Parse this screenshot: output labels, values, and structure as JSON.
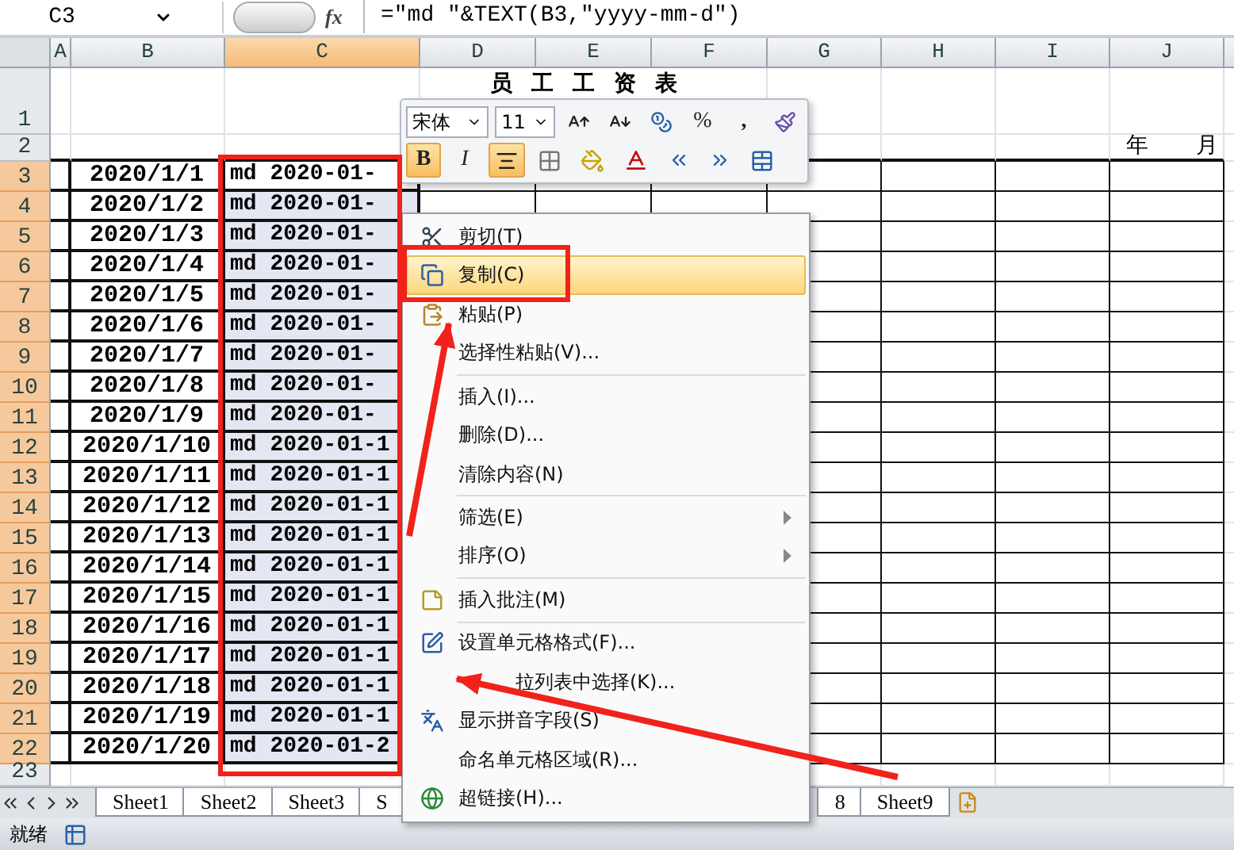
{
  "formula_bar": {
    "name_box": "C3",
    "fx": "fx",
    "formula": "=\"md \"&TEXT(B3,\"yyyy-mm-d\")"
  },
  "columns": [
    {
      "label": "A",
      "selected": false
    },
    {
      "label": "B",
      "selected": false
    },
    {
      "label": "C",
      "selected": true
    },
    {
      "label": "D",
      "selected": false
    },
    {
      "label": "E",
      "selected": false
    },
    {
      "label": "F",
      "selected": false
    },
    {
      "label": "G",
      "selected": false
    },
    {
      "label": "H",
      "selected": false
    },
    {
      "label": "I",
      "selected": false
    },
    {
      "label": "J",
      "selected": false
    }
  ],
  "title_row": {
    "row": "1",
    "title": "员工工资表"
  },
  "date_row": {
    "row": "2",
    "year": "年",
    "month": "月"
  },
  "rows": [
    {
      "row": "3",
      "b": "2020/1/1",
      "c": "md 2020-01-",
      "selected": true
    },
    {
      "row": "4",
      "b": "2020/1/2",
      "c": "md 2020-01-",
      "selected": true
    },
    {
      "row": "5",
      "b": "2020/1/3",
      "c": "md 2020-01-",
      "selected": true
    },
    {
      "row": "6",
      "b": "2020/1/4",
      "c": "md 2020-01-",
      "selected": true
    },
    {
      "row": "7",
      "b": "2020/1/5",
      "c": "md 2020-01-",
      "selected": true
    },
    {
      "row": "8",
      "b": "2020/1/6",
      "c": "md 2020-01-",
      "selected": true
    },
    {
      "row": "9",
      "b": "2020/1/7",
      "c": "md 2020-01-",
      "selected": true
    },
    {
      "row": "10",
      "b": "2020/1/8",
      "c": "md 2020-01-",
      "selected": true
    },
    {
      "row": "11",
      "b": "2020/1/9",
      "c": "md 2020-01-",
      "selected": true
    },
    {
      "row": "12",
      "b": "2020/1/10",
      "c": "md 2020-01-1",
      "selected": true
    },
    {
      "row": "13",
      "b": "2020/1/11",
      "c": "md 2020-01-1",
      "selected": true
    },
    {
      "row": "14",
      "b": "2020/1/12",
      "c": "md 2020-01-1",
      "selected": true
    },
    {
      "row": "15",
      "b": "2020/1/13",
      "c": "md 2020-01-1",
      "selected": true
    },
    {
      "row": "16",
      "b": "2020/1/14",
      "c": "md 2020-01-1",
      "selected": true
    },
    {
      "row": "17",
      "b": "2020/1/15",
      "c": "md 2020-01-1",
      "selected": true
    },
    {
      "row": "18",
      "b": "2020/1/16",
      "c": "md 2020-01-1",
      "selected": true
    },
    {
      "row": "19",
      "b": "2020/1/17",
      "c": "md 2020-01-1",
      "selected": true
    },
    {
      "row": "20",
      "b": "2020/1/18",
      "c": "md 2020-01-1",
      "selected": true
    },
    {
      "row": "21",
      "b": "2020/1/19",
      "c": "md 2020-01-1",
      "selected": true
    },
    {
      "row": "22",
      "b": "2020/1/20",
      "c": "md 2020-01-2",
      "selected": true
    }
  ],
  "empty_row": {
    "row": "23"
  },
  "mini_toolbar": {
    "font": "宋体",
    "size": "11",
    "percent": "%",
    "comma": ",",
    "bold": {
      "label": "B",
      "on": true
    },
    "italic": {
      "label": "I",
      "on": false
    },
    "center_align_on": true
  },
  "context_menu": [
    {
      "kind": "item",
      "label": "剪切(T)",
      "selected": false
    },
    {
      "kind": "item",
      "label": "复制(C)",
      "selected": true
    },
    {
      "kind": "item",
      "label": "粘贴(P)",
      "selected": false
    },
    {
      "kind": "item",
      "label": "选择性粘贴(V)...",
      "selected": false
    },
    {
      "kind": "separator"
    },
    {
      "kind": "item",
      "label": "插入(I)...",
      "selected": false
    },
    {
      "kind": "item",
      "label": "删除(D)...",
      "selected": false
    },
    {
      "kind": "item",
      "label": "清除内容(N)",
      "selected": false
    },
    {
      "kind": "separator"
    },
    {
      "kind": "submenu",
      "label": "筛选(E)",
      "selected": false
    },
    {
      "kind": "submenu",
      "label": "排序(O)",
      "selected": false
    },
    {
      "kind": "separator"
    },
    {
      "kind": "item",
      "label": "插入批注(M)",
      "selected": false
    },
    {
      "kind": "separator"
    },
    {
      "kind": "item",
      "label": "设置单元格格式(F)...",
      "selected": false
    },
    {
      "kind": "covered-item",
      "label": "拉列表中选择(K)...",
      "selected": false
    },
    {
      "kind": "item",
      "label": "显示拼音字段(S)",
      "selected": false
    },
    {
      "kind": "item",
      "label": "命名单元格区域(R)...",
      "selected": false
    },
    {
      "kind": "item",
      "label": "超链接(H)...",
      "selected": false
    }
  ],
  "sheet_tabs": [
    "Sheet1",
    "Sheet2",
    "Sheet3",
    "S",
    "8",
    "Sheet9"
  ],
  "status_bar": {
    "text": "就绪"
  }
}
